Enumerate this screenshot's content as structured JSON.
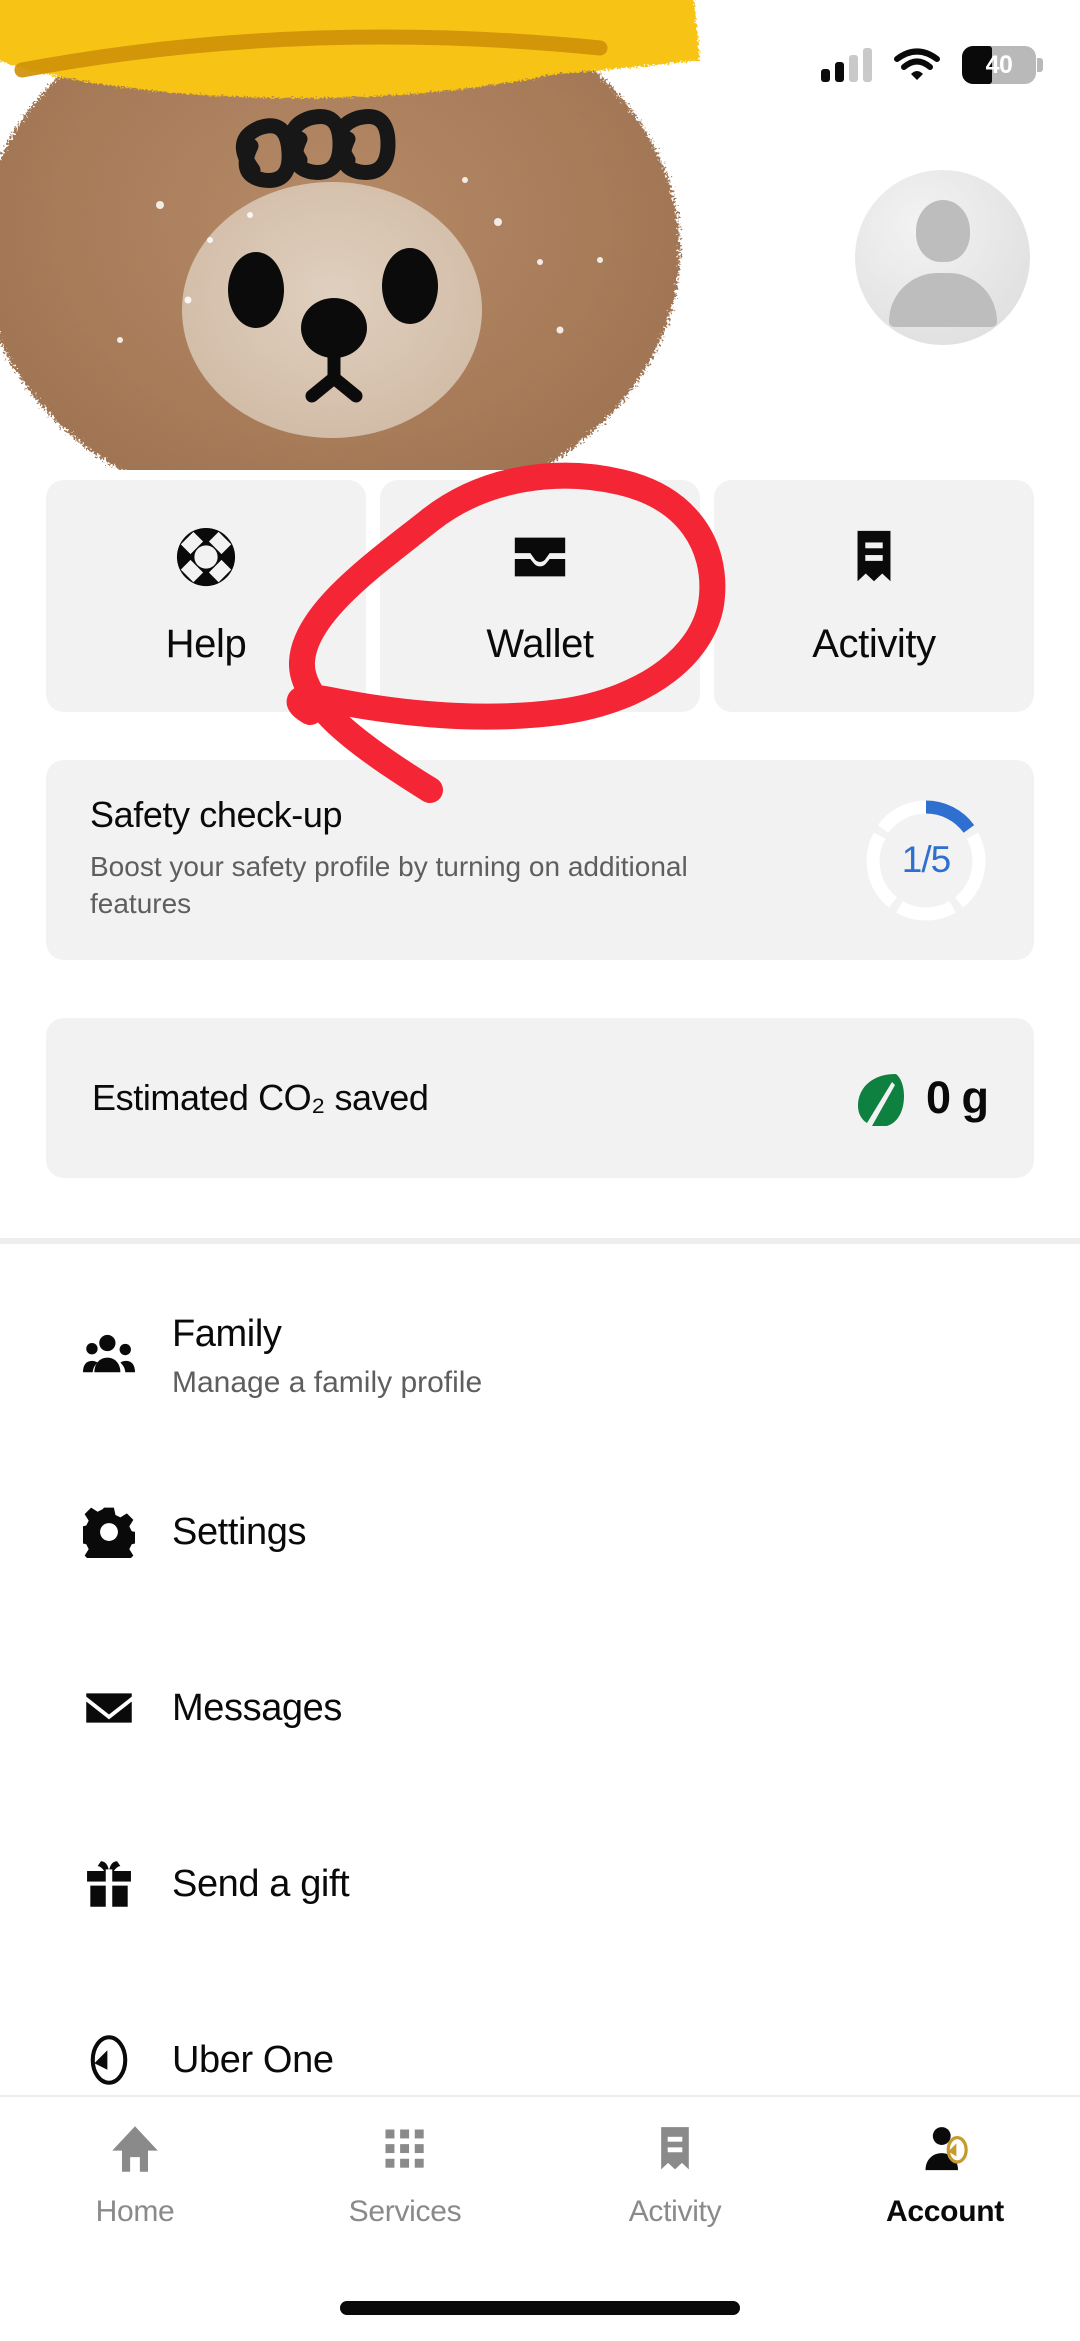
{
  "status_bar": {
    "signal_icon": "cellular-signal-icon",
    "signal_bars_filled": 2,
    "signal_bars_total": 4,
    "wifi_icon": "wifi-icon",
    "battery_icon": "battery-icon",
    "battery_percent": "40"
  },
  "header": {
    "illustration": "bear-with-yellow-hat-illustration",
    "avatar": "user-avatar-placeholder"
  },
  "quick_actions": [
    {
      "label": "Help",
      "icon": "lifebuoy-icon"
    },
    {
      "label": "Wallet",
      "icon": "wallet-icon"
    },
    {
      "label": "Activity",
      "icon": "receipt-icon"
    }
  ],
  "safety_card": {
    "title": "Safety check-up",
    "subtitle": "Boost your safety profile by turning on additional features",
    "progress_label": "1/5",
    "progress_completed": 1,
    "progress_total": 5,
    "progress_color": "#2f6fd0",
    "track_color": "#ffffff"
  },
  "co2_card": {
    "label": "Estimated CO₂ saved",
    "icon": "leaf-icon",
    "icon_color": "#0e8040",
    "value": "0 g"
  },
  "menu": [
    {
      "title": "Family",
      "subtitle": "Manage a family profile",
      "icon": "family-group-icon"
    },
    {
      "title": "Settings",
      "subtitle": "",
      "icon": "gear-icon"
    },
    {
      "title": "Messages",
      "subtitle": "",
      "icon": "envelope-icon"
    },
    {
      "title": "Send a gift",
      "subtitle": "",
      "icon": "gift-icon"
    },
    {
      "title": "Uber One",
      "subtitle": "",
      "icon": "uber-one-icon"
    }
  ],
  "bottom_nav": [
    {
      "label": "Home",
      "icon": "home-icon",
      "active": false
    },
    {
      "label": "Services",
      "icon": "grid-icon",
      "active": false
    },
    {
      "label": "Activity",
      "icon": "receipt-icon",
      "active": false
    },
    {
      "label": "Account",
      "icon": "person-uber-one-icon",
      "active": true
    }
  ],
  "annotation": {
    "type": "hand-drawn-lasso-circle",
    "color": "#f42534",
    "target": "Wallet"
  }
}
